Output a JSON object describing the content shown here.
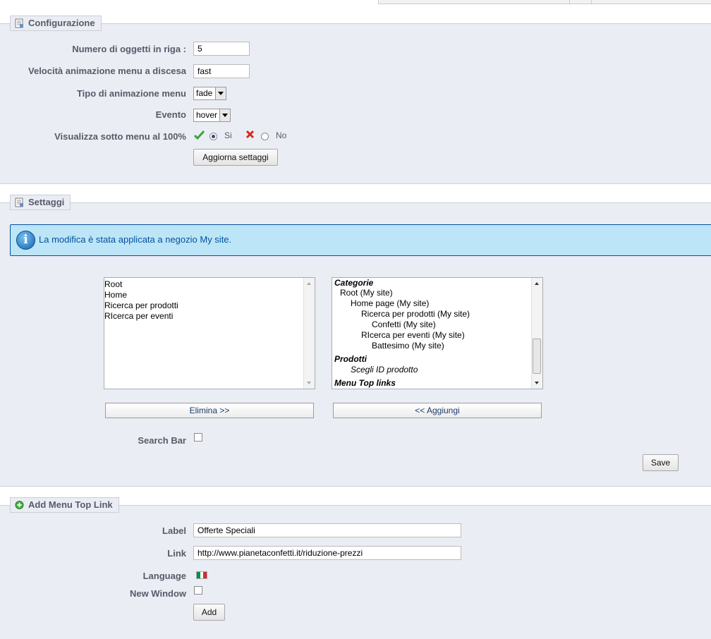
{
  "configurazione": {
    "legend": "Configurazione",
    "fields": {
      "numero_oggetti": {
        "label": "Numero di oggetti in riga :",
        "value": "5"
      },
      "velocita": {
        "label": "Velocità animazione menu a discesa",
        "value": "fast"
      },
      "tipo_animazione": {
        "label": "Tipo di animazione menu",
        "value": "fade"
      },
      "evento": {
        "label": "Evento",
        "value": "hover"
      },
      "visualizza": {
        "label": "Visualizza sotto menu al 100%",
        "yes_label": "Si",
        "no_label": "No",
        "selected": "yes"
      }
    },
    "submit_label": "Aggiorna settaggi"
  },
  "settaggi": {
    "legend": "Settaggi",
    "info_message": "La modifica è stata applicata a negozio My site.",
    "selected_items": [
      "Root",
      "Home",
      "Ricerca per prodotti",
      "RIcerca per eventi"
    ],
    "available": {
      "group1": "Categorie",
      "cat_items": [
        {
          "label": "Root (My site)",
          "level": 1
        },
        {
          "label": "Home page (My site)",
          "level": 2
        },
        {
          "label": "Ricerca per prodotti (My site)",
          "level": 3
        },
        {
          "label": "Confetti (My site)",
          "level": 4
        },
        {
          "label": "RIcerca per eventi (My site)",
          "level": 3
        },
        {
          "label": "Battesimo (My site)",
          "level": 4
        }
      ],
      "group2": "Prodotti",
      "prod_item": "Scegli ID prodotto",
      "group3": "Menu Top links"
    },
    "remove_label": "Elimina >>",
    "add_label": "<< Aggiungi",
    "search_bar_label": "Search Bar",
    "save_label": "Save"
  },
  "add_link": {
    "legend": "Add Menu Top Link",
    "label_field": {
      "label": "Label",
      "value": "Offerte Speciali"
    },
    "link_field": {
      "label": "Link",
      "value": "http://www.pianetaconfetti.it/riduzione-prezzi"
    },
    "language_label": "Language",
    "new_window_label": "New Window",
    "add_label": "Add",
    "flag_colors": [
      "#009246",
      "#ffffff",
      "#ce2b37"
    ]
  },
  "colors": {
    "panel_bg": "#ebedf4",
    "legend_text": "#585a69",
    "info_bg": "#bde5f8",
    "info_text": "#00529b",
    "check_green": "#3aa53a",
    "cross_red": "#d9261c"
  }
}
